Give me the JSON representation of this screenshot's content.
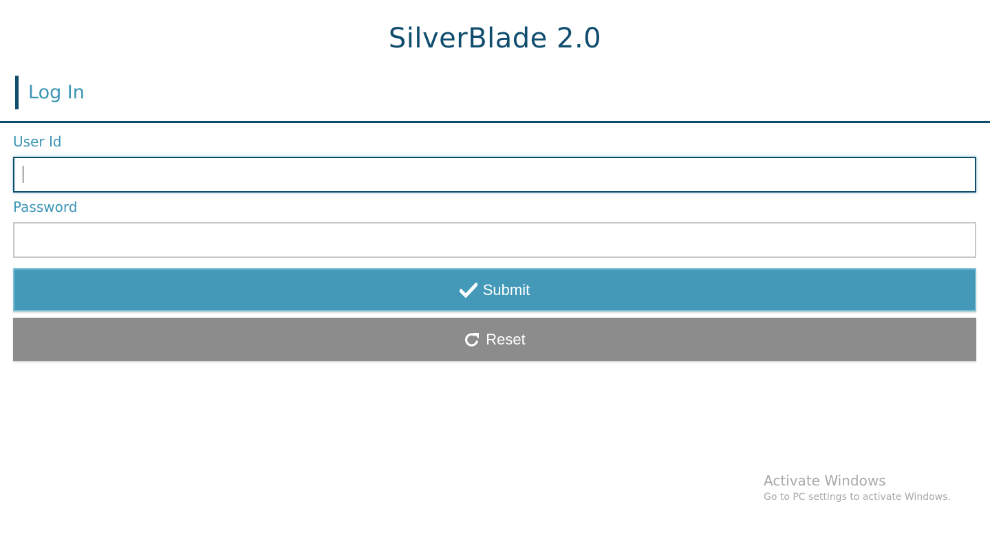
{
  "app": {
    "title": "SilverBlade 2.0"
  },
  "login": {
    "heading": "Log In",
    "user_id_label": "User Id",
    "user_id_value": "",
    "password_label": "Password",
    "password_value": "",
    "submit_label": "Submit",
    "submit_icon": "checkmark-icon",
    "reset_label": "Reset",
    "reset_icon": "refresh-icon"
  },
  "watermark": {
    "title": "Activate Windows",
    "subtitle": "Go to PC settings to activate Windows."
  },
  "colors": {
    "title": "#0f4d6e",
    "accent_text": "#3b95b5",
    "submit_bg": "#4399b7",
    "reset_bg": "#8c8c8c"
  }
}
